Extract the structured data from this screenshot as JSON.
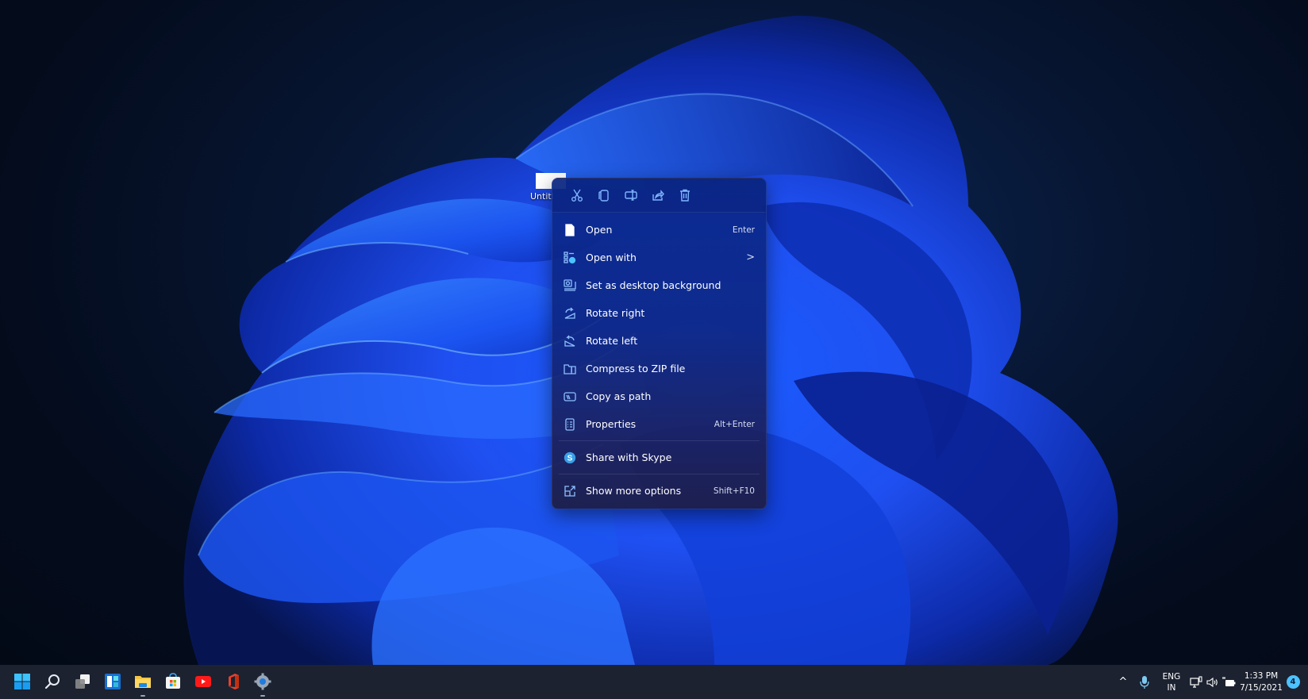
{
  "desktop": {
    "wallpaper": "Windows 11 Bloom (blue)",
    "selected_file": {
      "label": "Untitl"
    }
  },
  "context_menu": {
    "quick_actions": [
      {
        "name": "cut",
        "icon": "scissors-icon"
      },
      {
        "name": "copy",
        "icon": "copy-icon"
      },
      {
        "name": "rename",
        "icon": "rename-icon"
      },
      {
        "name": "share",
        "icon": "share-icon"
      },
      {
        "name": "delete",
        "icon": "trash-icon"
      }
    ],
    "items": [
      {
        "label": "Open",
        "shortcut": "Enter",
        "icon": "file-icon"
      },
      {
        "label": "Open with",
        "shortcut": "",
        "submenu": ">",
        "icon": "open-with-icon"
      },
      {
        "label": "Set as desktop background",
        "shortcut": "",
        "icon": "desktop-background-icon"
      },
      {
        "label": "Rotate right",
        "shortcut": "",
        "icon": "rotate-right-icon"
      },
      {
        "label": "Rotate left",
        "shortcut": "",
        "icon": "rotate-left-icon"
      },
      {
        "label": "Compress to ZIP file",
        "shortcut": "",
        "icon": "zip-folder-icon"
      },
      {
        "label": "Copy as path",
        "shortcut": "",
        "icon": "copy-path-icon"
      },
      {
        "label": "Properties",
        "shortcut": "Alt+Enter",
        "icon": "properties-icon"
      },
      {
        "label": "Share with Skype",
        "shortcut": "",
        "icon": "skype-icon"
      },
      {
        "label": "Show more options",
        "shortcut": "Shift+F10",
        "icon": "more-options-icon"
      }
    ]
  },
  "taskbar": {
    "apps": [
      {
        "name": "Start",
        "icon": "windows-start-icon",
        "running": false
      },
      {
        "name": "Search",
        "icon": "search-icon",
        "running": false
      },
      {
        "name": "Task View",
        "icon": "task-view-icon",
        "running": false
      },
      {
        "name": "Widgets",
        "icon": "widgets-icon",
        "running": false
      },
      {
        "name": "File Explorer",
        "icon": "file-explorer-icon",
        "running": true
      },
      {
        "name": "Microsoft Store",
        "icon": "store-icon",
        "running": false
      },
      {
        "name": "YouTube",
        "icon": "youtube-icon",
        "running": false
      },
      {
        "name": "Office",
        "icon": "office-icon",
        "running": false
      },
      {
        "name": "Settings",
        "icon": "settings-icon",
        "running": true
      }
    ],
    "tray": {
      "overflow": "^",
      "language": {
        "line1": "ENG",
        "line2": "IN"
      },
      "time": "1:33 PM",
      "date": "7/15/2021",
      "notification_count": "4"
    }
  },
  "colors": {
    "accent": "#4cc2ff",
    "menu_icon": "#8ec0ff",
    "taskbar_bg": "#1c2230"
  }
}
